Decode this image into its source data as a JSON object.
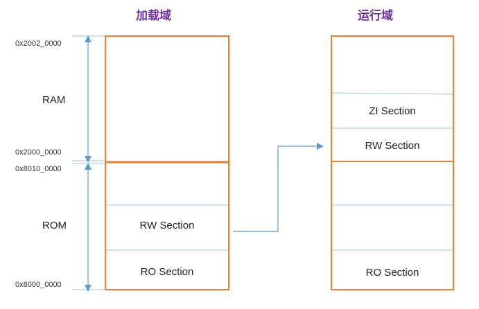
{
  "headings": {
    "load": "加载域",
    "run": "运行域"
  },
  "addresses": {
    "ram_top": "0x2002_0000",
    "ram_bottom": "0x2000_0000",
    "rom_top": "0x8010_0000",
    "rom_bottom": "0x8000_0000"
  },
  "regions": {
    "ram": "RAM",
    "rom": "ROM"
  },
  "load_sections": {
    "rw": "RW Section",
    "ro": "RO Section"
  },
  "run_sections": {
    "zi": "ZI Section",
    "rw": "RW Section",
    "ro": "RO Section"
  },
  "colors": {
    "box_border": "#ed7d31",
    "divider": "#9dc3e6",
    "arrow": "#5b9bd5",
    "heading": "#7030a0"
  }
}
